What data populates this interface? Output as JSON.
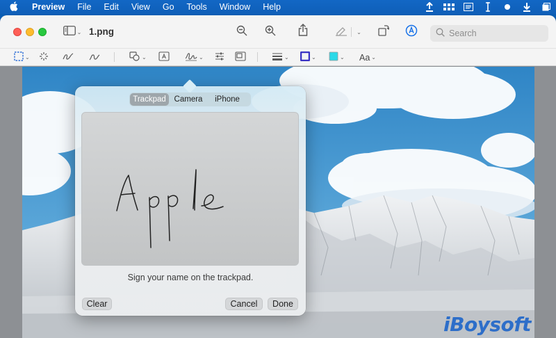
{
  "menubar": {
    "app_name": "Preview",
    "items": [
      "File",
      "Edit",
      "View",
      "Go",
      "Tools",
      "Window",
      "Help"
    ],
    "status_icons": [
      "upload-icon",
      "grid-icon",
      "notes-icon",
      "cursor-icon",
      "dot-icon",
      "download-icon",
      "copy-icon"
    ]
  },
  "window": {
    "document_title": "1.png",
    "search_placeholder": "Search",
    "toolbar_icons": [
      "sidebar-icon",
      "zoom-out-icon",
      "zoom-in-icon",
      "share-icon",
      "highlight-icon",
      "rotate-icon",
      "markup-icon"
    ],
    "markup_tools": [
      "rect-select-icon",
      "instant-alpha-icon",
      "sketch-icon",
      "draw-icon",
      "shapes-icon",
      "text-icon",
      "sign-icon",
      "adjust-color-icon",
      "adjust-size-icon",
      "line-style-icon",
      "border-color-icon",
      "fill-color-icon",
      "text-style-icon"
    ],
    "text_style_label": "Aa",
    "border_color": "#3a33c4",
    "fill_color": "#2ad9e8"
  },
  "signature_popover": {
    "tabs": [
      "Trackpad",
      "Camera",
      "iPhone"
    ],
    "active_tab": "Trackpad",
    "signature_text": "Apple",
    "instruction": "Sign your name on the trackpad.",
    "clear_label": "Clear",
    "cancel_label": "Cancel",
    "done_label": "Done"
  },
  "watermark": "iBoysoft",
  "colors": {
    "menubar_bg": "#1267c5",
    "accent": "#1a73e8",
    "sky": "#3e92cc"
  }
}
